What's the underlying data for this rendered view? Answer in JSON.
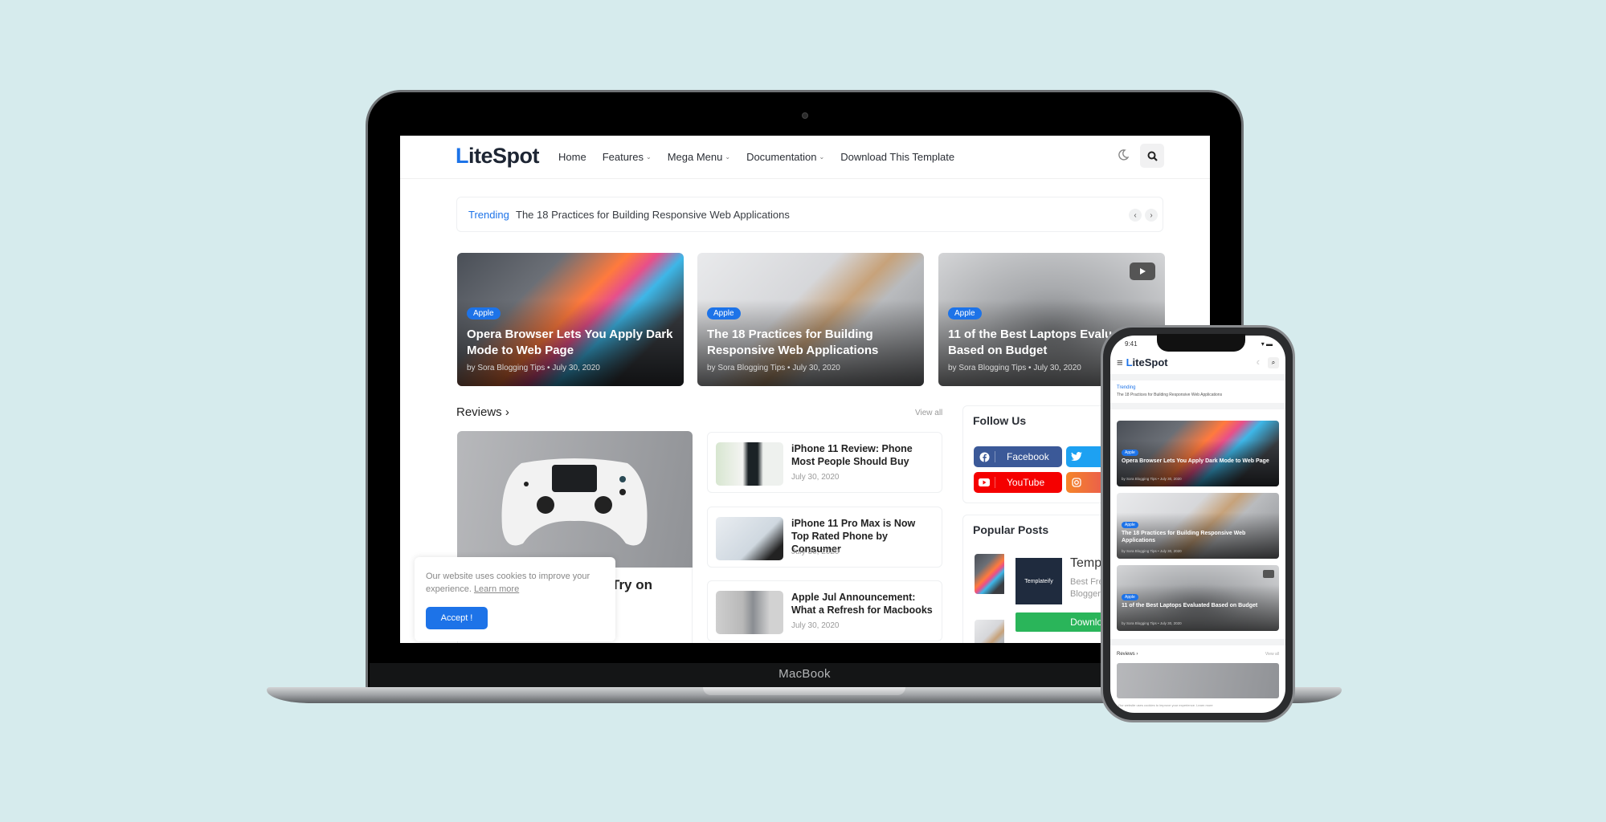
{
  "device": {
    "laptop_brand": "MacBook"
  },
  "site": {
    "logo_first": "L",
    "logo_rest": "iteSpot",
    "nav": [
      {
        "label": "Home",
        "has_dropdown": false
      },
      {
        "label": "Features",
        "has_dropdown": true
      },
      {
        "label": "Mega Menu",
        "has_dropdown": true
      },
      {
        "label": "Documentation",
        "has_dropdown": true
      },
      {
        "label": "Download This Template",
        "has_dropdown": false
      }
    ],
    "icons": {
      "theme_toggle": "moon-icon",
      "search": "search-icon"
    },
    "dropdown_glyph": "⌄"
  },
  "trending": {
    "label": "Trending",
    "text": "The 18 Practices for Building Responsive Web Applications",
    "prev": "‹",
    "next": "›"
  },
  "featured": [
    {
      "badge": "Apple",
      "title": "Opera Browser Lets You Apply Dark Mode to Web Page",
      "meta": "by Sora Blogging Tips • July 30, 2020",
      "video": false
    },
    {
      "badge": "Apple",
      "title": "The 18 Practices for Building Responsive Web Applications",
      "meta": "by Sora Blogging Tips • July 30, 2020",
      "video": false
    },
    {
      "badge": "Apple",
      "title": "11 of the Best Laptops Evaluated Based on Budget",
      "meta": "by Sora Blogging Tips • July 30, 2020",
      "video": true
    }
  ],
  "reviews": {
    "heading": "Reviews ›",
    "view_all": "View all",
    "main_title_fragment": "Try on",
    "items": [
      {
        "title": "iPhone 11 Review: Phone Most People Should Buy",
        "date": "July 30, 2020"
      },
      {
        "title": "iPhone 11 Pro Max is Now Top Rated Phone by Consumer",
        "date": "July 30, 2020"
      },
      {
        "title": "Apple Jul Announcement: What a Refresh for Macbooks",
        "date": "July 30, 2020"
      }
    ]
  },
  "sidebar": {
    "follow_heading": "Follow Us",
    "social": [
      {
        "name": "Facebook",
        "color": "#3b5998"
      },
      {
        "name": "Twitter",
        "color": "#1da1f2"
      },
      {
        "name": "YouTube",
        "color": "#f50000"
      },
      {
        "name": "Instagram",
        "color": "#e1306c"
      }
    ],
    "popular_heading": "Popular Posts"
  },
  "ad": {
    "logo_text": "Templateify",
    "title": "Templ",
    "subtitle_1": "Best Fre",
    "subtitle_2": "Blogger",
    "button": "Download T",
    "button_color": "#2ab55a"
  },
  "cookie": {
    "text": "Our website uses cookies to improve your experience.",
    "link": "Learn more",
    "accept": "Accept !"
  },
  "phone": {
    "time": "9:41",
    "status": "▾ ▬",
    "menu": "≡",
    "trending_label": "Trending",
    "trending_text": "The 18 Practices for Building Responsive Web Applications",
    "featured": [
      {
        "badge": "Apple",
        "title": "Opera Browser Lets You Apply Dark Mode to Web Page",
        "meta": "by Sora Blogging Tips • July 30, 2020"
      },
      {
        "badge": "Apple",
        "title": "The 18 Practices for Building Responsive Web Applications",
        "meta": "by Sora Blogging Tips • July 30, 2020"
      },
      {
        "badge": "Apple",
        "title": "11 of the Best Laptops Evaluated Based on Budget",
        "meta": "by Sora Blogging Tips • July 30, 2020"
      }
    ],
    "reviews_heading": "Reviews ›",
    "view_all": "View all",
    "cookie_text": "Our website uses cookies to improve your experience. Learn more"
  },
  "colors": {
    "accent": "#1d73e8",
    "background": "#d6ebed"
  }
}
